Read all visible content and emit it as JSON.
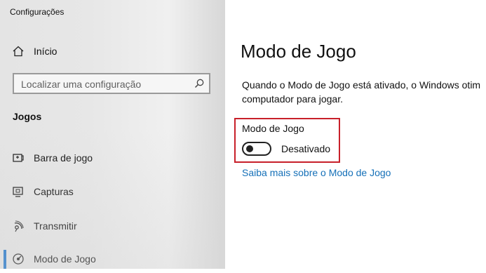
{
  "window": {
    "title": "Configurações"
  },
  "sidebar": {
    "home": {
      "label": "Início",
      "icon": "home-icon"
    },
    "search": {
      "placeholder": "Localizar uma configuração",
      "icon": "search-icon"
    },
    "section_title": "Jogos",
    "items": [
      {
        "label": "Barra de jogo",
        "icon": "game-bar-icon"
      },
      {
        "label": "Capturas",
        "icon": "captures-icon"
      },
      {
        "label": "Transmitir",
        "icon": "broadcast-icon"
      },
      {
        "label": "Modo de Jogo",
        "icon": "game-mode-icon",
        "selected": true
      }
    ]
  },
  "main": {
    "title": "Modo de Jogo",
    "description_line1": "Quando o Modo de Jogo está ativado, o Windows otim",
    "description_line2": "computador para jogar.",
    "toggle": {
      "label": "Modo de Jogo",
      "state_text": "Desativado",
      "on": false
    },
    "link": "Saiba mais sobre o Modo de Jogo"
  },
  "colors": {
    "accent": "#1670c9",
    "highlight": "#c8202a",
    "link": "#1570b8"
  }
}
